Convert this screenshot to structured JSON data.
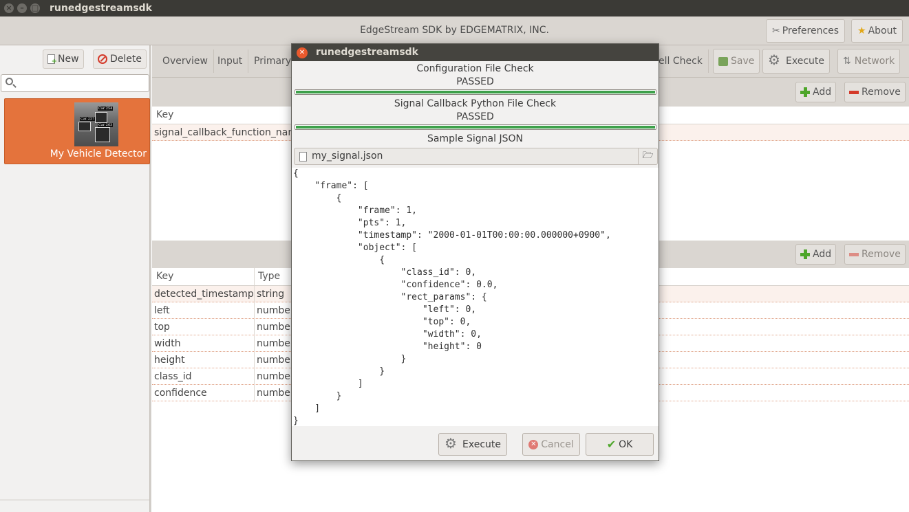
{
  "window": {
    "title": "runedgestreamsdk"
  },
  "header": {
    "title": "EdgeStream SDK by EDGEMATRIX, INC.",
    "preferences_label": "Preferences",
    "about_label": "About"
  },
  "sidebar": {
    "new_label": "New",
    "delete_label": "Delete",
    "search_value": "",
    "items": [
      {
        "label": "My Vehicle Detector",
        "thumb_labels": [
          "Car 254",
          "Car 257",
          "Car 263"
        ]
      }
    ]
  },
  "tabs": {
    "items": [
      "Overview",
      "Input",
      "Primary",
      "ell Check"
    ],
    "save_label": "Save",
    "execute_label": "Execute",
    "network_label": "Network"
  },
  "section1": {
    "add_label": "Add",
    "remove_label": "Remove",
    "col_key": "Key",
    "rows": [
      {
        "key": "signal_callback_function_nam"
      }
    ]
  },
  "section2": {
    "add_label": "Add",
    "remove_label": "Remove",
    "col_key": "Key",
    "col_type": "Type",
    "rows": [
      {
        "key": "detected_timestamp",
        "type": "string"
      },
      {
        "key": "left",
        "type": "number"
      },
      {
        "key": "top",
        "type": "number"
      },
      {
        "key": "width",
        "type": "number"
      },
      {
        "key": "height",
        "type": "number"
      },
      {
        "key": "class_id",
        "type": "number"
      },
      {
        "key": "confidence",
        "type": "number"
      }
    ]
  },
  "dialog": {
    "title": "runedgestreamsdk",
    "config_check_label": "Configuration File Check",
    "config_check_status": "PASSED",
    "config_check_progress": 1.0,
    "callback_check_label": "Signal Callback Python File Check",
    "callback_check_status": "PASSED",
    "callback_check_progress": 1.0,
    "sample_label": "Sample Signal JSON",
    "file_name": "my_signal.json",
    "json_text": "{\n    \"frame\": [\n        {\n            \"frame\": 1,\n            \"pts\": 1,\n            \"timestamp\": \"2000-01-01T00:00:00.000000+0900\",\n            \"object\": [\n                {\n                    \"class_id\": 0,\n                    \"confidence\": 0.0,\n                    \"rect_params\": {\n                        \"left\": 0,\n                        \"top\": 0,\n                        \"width\": 0,\n                        \"height\": 0\n                    }\n                }\n            ]\n        }\n    ]\n}",
    "execute_label": "Execute",
    "cancel_label": "Cancel",
    "ok_label": "OK"
  }
}
